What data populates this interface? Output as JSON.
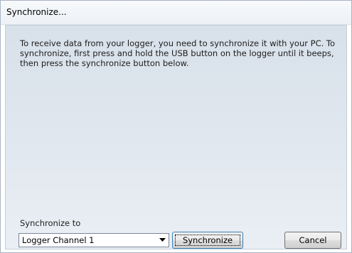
{
  "window": {
    "title": "Synchronize..."
  },
  "instructions": "To receive data from your logger, you need to synchronize it with your PC. To synchronize, first press and hold the USB button on the logger until it beeps, then press the synchronize button below.",
  "sync_to": {
    "label": "Synchronize to",
    "selected": "Logger Channel 1",
    "dropdown_icon": "chevron-down-icon"
  },
  "buttons": {
    "synchronize": "Synchronize",
    "cancel": "Cancel"
  },
  "colors": {
    "panel_gradient_top": "#d8e1ea",
    "panel_gradient_bottom": "#eaeff4",
    "default_button_border": "#3c7fb1"
  }
}
